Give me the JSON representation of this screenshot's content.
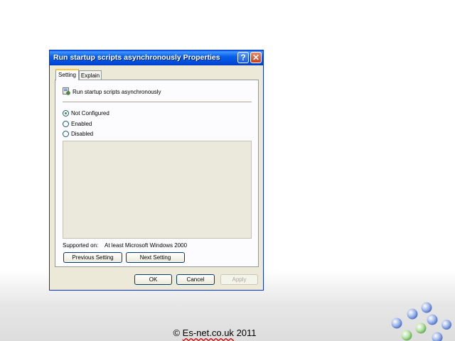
{
  "dialog": {
    "title": "Run startup scripts asynchronously Properties",
    "help_glyph": "?",
    "close_glyph": "✕",
    "tabs": [
      {
        "label": "Setting",
        "active": true
      },
      {
        "label": "Explain",
        "active": false
      }
    ],
    "policy_icon": "policy-icon",
    "policy_name": "Run startup scripts asynchronously",
    "options": [
      {
        "label": "Not Configured",
        "checked": true
      },
      {
        "label": "Enabled",
        "checked": false
      },
      {
        "label": "Disabled",
        "checked": false
      }
    ],
    "supported_label": "Supported on:",
    "supported_value": "At least Microsoft Windows 2000",
    "buttons": {
      "previous": "Previous Setting",
      "next": "Next Setting",
      "ok": "OK",
      "cancel": "Cancel",
      "apply": "Apply"
    }
  },
  "footer": {
    "symbol": "©",
    "domain": "Es-net.co.uk",
    "year": "2011"
  },
  "colors": {
    "title_bar": "#0a5fe8",
    "dialog_bg": "#ece9d8",
    "radio_checked": "#21a121",
    "logo_blue": "#7f9fe0",
    "logo_green": "#8fd07f"
  }
}
